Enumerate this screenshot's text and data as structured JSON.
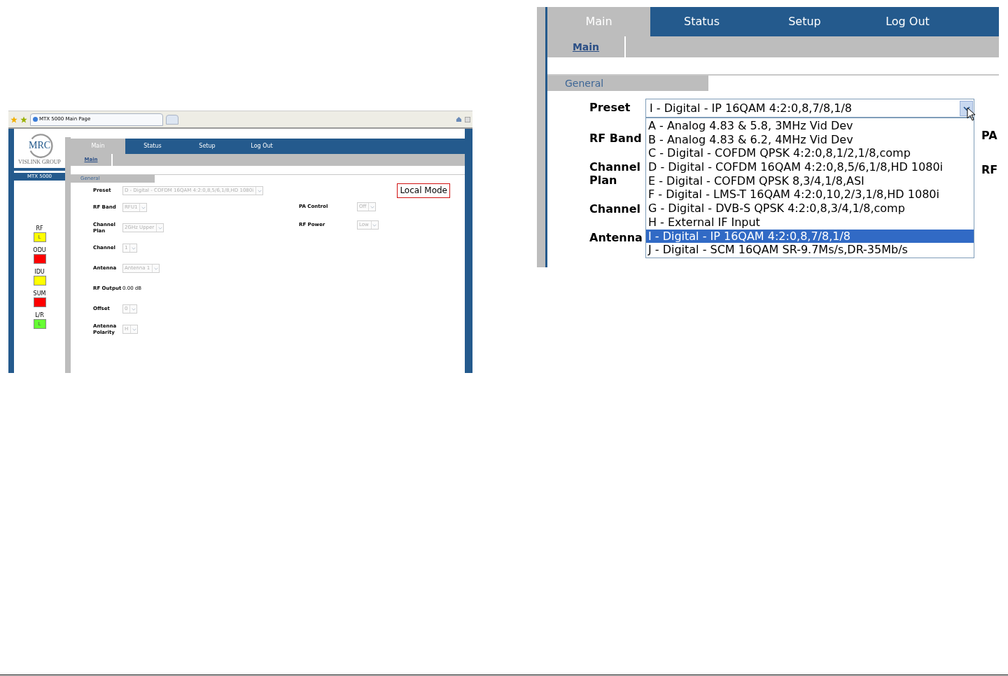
{
  "main_page": {
    "browser": {
      "tab_title": "MTX 5000 Main Page"
    },
    "sidebar": {
      "logo_text": "MRC",
      "logo_subtitle": "VISLINK GROUP",
      "device": "MTX 5000",
      "indicators": [
        {
          "label": "RF",
          "color": "#ffff00",
          "value": "L"
        },
        {
          "label": "ODU",
          "color": "#ff0000"
        },
        {
          "label": "IDU",
          "color": "#ffff00"
        },
        {
          "label": "SUM",
          "color": "#ff0000"
        },
        {
          "label": "L/R",
          "color": "#66ff33",
          "value": "L"
        }
      ]
    },
    "tabs": [
      {
        "label": "Main",
        "selected": true
      },
      {
        "label": "Status",
        "selected": false
      },
      {
        "label": "Setup",
        "selected": false
      },
      {
        "label": "Log Out",
        "selected": false
      }
    ],
    "subtabs": [
      "Main"
    ],
    "section": "General",
    "mode_badge": "Local Mode",
    "preset": {
      "label": "Preset",
      "value": "D - Digital - COFDM 16QAM 4:2:0,8,5/6,1/8,HD 1080i",
      "disabled": true
    },
    "left_fields": [
      {
        "kind": "select",
        "label": "RF Band",
        "value": "RFU1",
        "disabled": true
      },
      {
        "kind": "select",
        "label": "Channel Plan",
        "value": "2GHz Upper",
        "disabled": true
      },
      {
        "kind": "select",
        "label": "Channel",
        "value": "1",
        "disabled": true
      },
      {
        "kind": "select",
        "label": "Antenna",
        "value": "Antenna 1",
        "disabled": true
      },
      {
        "kind": "text",
        "label": "RF Output",
        "value": "0.00 dB"
      },
      {
        "kind": "select",
        "label": "Offset",
        "value": "0",
        "disabled": true
      },
      {
        "kind": "select",
        "label": "Antenna Polarity",
        "value": "H",
        "disabled": true
      }
    ],
    "right_fields": [
      {
        "kind": "select",
        "label": "PA Control",
        "value": "Off",
        "disabled": true
      },
      {
        "kind": "select",
        "label": "RF Power",
        "value": "Low",
        "disabled": true
      }
    ]
  },
  "dropdown_view": {
    "tabs": [
      {
        "label": "Main",
        "selected": true
      },
      {
        "label": "Status",
        "selected": false
      },
      {
        "label": "Setup",
        "selected": false
      },
      {
        "label": "Log Out",
        "selected": false
      }
    ],
    "subtabs": [
      "Main"
    ],
    "section": "General",
    "preset": {
      "label": "Preset",
      "value": "I - Digital - IP 16QAM 4:2:0,8,7/8,1/8",
      "expanded": true,
      "options": [
        {
          "label": "A - Analog 4.83 & 5.8, 3MHz Vid Dev",
          "selected": false
        },
        {
          "label": "B - Analog 4.83 & 6.2, 4MHz Vid Dev",
          "selected": false
        },
        {
          "label": "C - Digital - COFDM QPSK 4:2:0,8,1/2,1/8,comp",
          "selected": false
        },
        {
          "label": "D - Digital - COFDM 16QAM 4:2:0,8,5/6,1/8,HD 1080i",
          "selected": false
        },
        {
          "label": "E - Digital - COFDM QPSK 8,3/4,1/8,ASI",
          "selected": false
        },
        {
          "label": "F - Digital - LMS-T 16QAM 4:2:0,10,2/3,1/8,HD 1080i",
          "selected": false
        },
        {
          "label": "G - Digital - DVB-S QPSK 4:2:0,8,3/4,1/8,comp",
          "selected": false
        },
        {
          "label": "H - External IF Input",
          "selected": false
        },
        {
          "label": "I - Digital - IP 16QAM 4:2:0,8,7/8,1/8",
          "selected": true
        },
        {
          "label": "J - Digital - SCM 16QAM SR-9.7Ms/s,DR-35Mb/s",
          "selected": false
        }
      ]
    },
    "left_labels": [
      "RF Band",
      "Channel Plan",
      "Channel",
      "Antenna"
    ],
    "right_labels": [
      "PA",
      "RF"
    ]
  }
}
